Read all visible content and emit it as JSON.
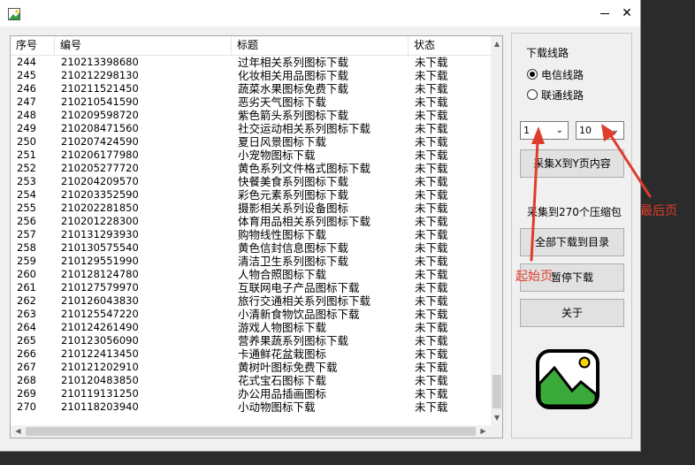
{
  "window": {
    "close_glyph": "✕"
  },
  "table": {
    "headers": [
      "序号",
      "编号",
      "标题",
      "状态"
    ],
    "rows": [
      [
        "244",
        "210213398680",
        "过年相关系列图标下载",
        "未下载"
      ],
      [
        "245",
        "210212298130",
        "化妆相关用品图标下载",
        "未下载"
      ],
      [
        "246",
        "210211521450",
        "蔬菜水果图标免费下载",
        "未下载"
      ],
      [
        "247",
        "210210541590",
        "恶劣天气图标下载",
        "未下载"
      ],
      [
        "248",
        "210209598720",
        "紫色箭头系列图标下载",
        "未下载"
      ],
      [
        "249",
        "210208471560",
        "社交运动相关系列图标下载",
        "未下载"
      ],
      [
        "250",
        "210207424590",
        "夏日风景图标下载",
        "未下载"
      ],
      [
        "251",
        "210206177980",
        "小宠物图标下载",
        "未下载"
      ],
      [
        "252",
        "210205277720",
        "黄色系列文件格式图标下载",
        "未下载"
      ],
      [
        "253",
        "210204209570",
        "快餐美食系列图标下载",
        "未下载"
      ],
      [
        "254",
        "210203352590",
        "彩色元素系列图标下载",
        "未下载"
      ],
      [
        "255",
        "210202281850",
        "摄影相关系列设备图标",
        "未下载"
      ],
      [
        "256",
        "210201228300",
        "体育用品相关系列图标下载",
        "未下载"
      ],
      [
        "257",
        "210131293930",
        "购物线性图标下载",
        "未下载"
      ],
      [
        "258",
        "210130575540",
        "黄色信封信息图标下载",
        "未下载"
      ],
      [
        "259",
        "210129551990",
        "清洁卫生系列图标下载",
        "未下载"
      ],
      [
        "260",
        "210128124780",
        "人物合照图标下载",
        "未下载"
      ],
      [
        "261",
        "210127579970",
        "互联网电子产品图标下载",
        "未下载"
      ],
      [
        "262",
        "210126043830",
        "旅行交通相关系列图标下载",
        "未下载"
      ],
      [
        "263",
        "210125547220",
        "小清新食物饮品图标下载",
        "未下载"
      ],
      [
        "264",
        "210124261490",
        "游戏人物图标下载",
        "未下载"
      ],
      [
        "265",
        "210123056090",
        "营养果蔬系列图标下载",
        "未下载"
      ],
      [
        "266",
        "210122413450",
        "卡通鲜花盆栽图标",
        "未下载"
      ],
      [
        "267",
        "210121202910",
        "黄树叶图标免费下载",
        "未下载"
      ],
      [
        "268",
        "210120483850",
        "花式宝石图标下载",
        "未下载"
      ],
      [
        "269",
        "210119131250",
        "办公用品插画图标",
        "未下载"
      ],
      [
        "270",
        "210118203940",
        "小动物图标下载",
        "未下载"
      ]
    ]
  },
  "panel": {
    "line_label": "下载线路",
    "radio_telecom": "电信线路",
    "radio_unicom": "联通线路",
    "start_page": "1",
    "end_page": "10",
    "collect_button": "采集X到Y页内容",
    "collected_status": "采集到270个压缩包",
    "download_all_button": "全部下载到目录",
    "pause_button": "暂停下载",
    "about_button": "关于"
  },
  "annotations": {
    "start_page_label": "起始页",
    "end_page_label": "最后页",
    "color": "#e03c2c"
  }
}
